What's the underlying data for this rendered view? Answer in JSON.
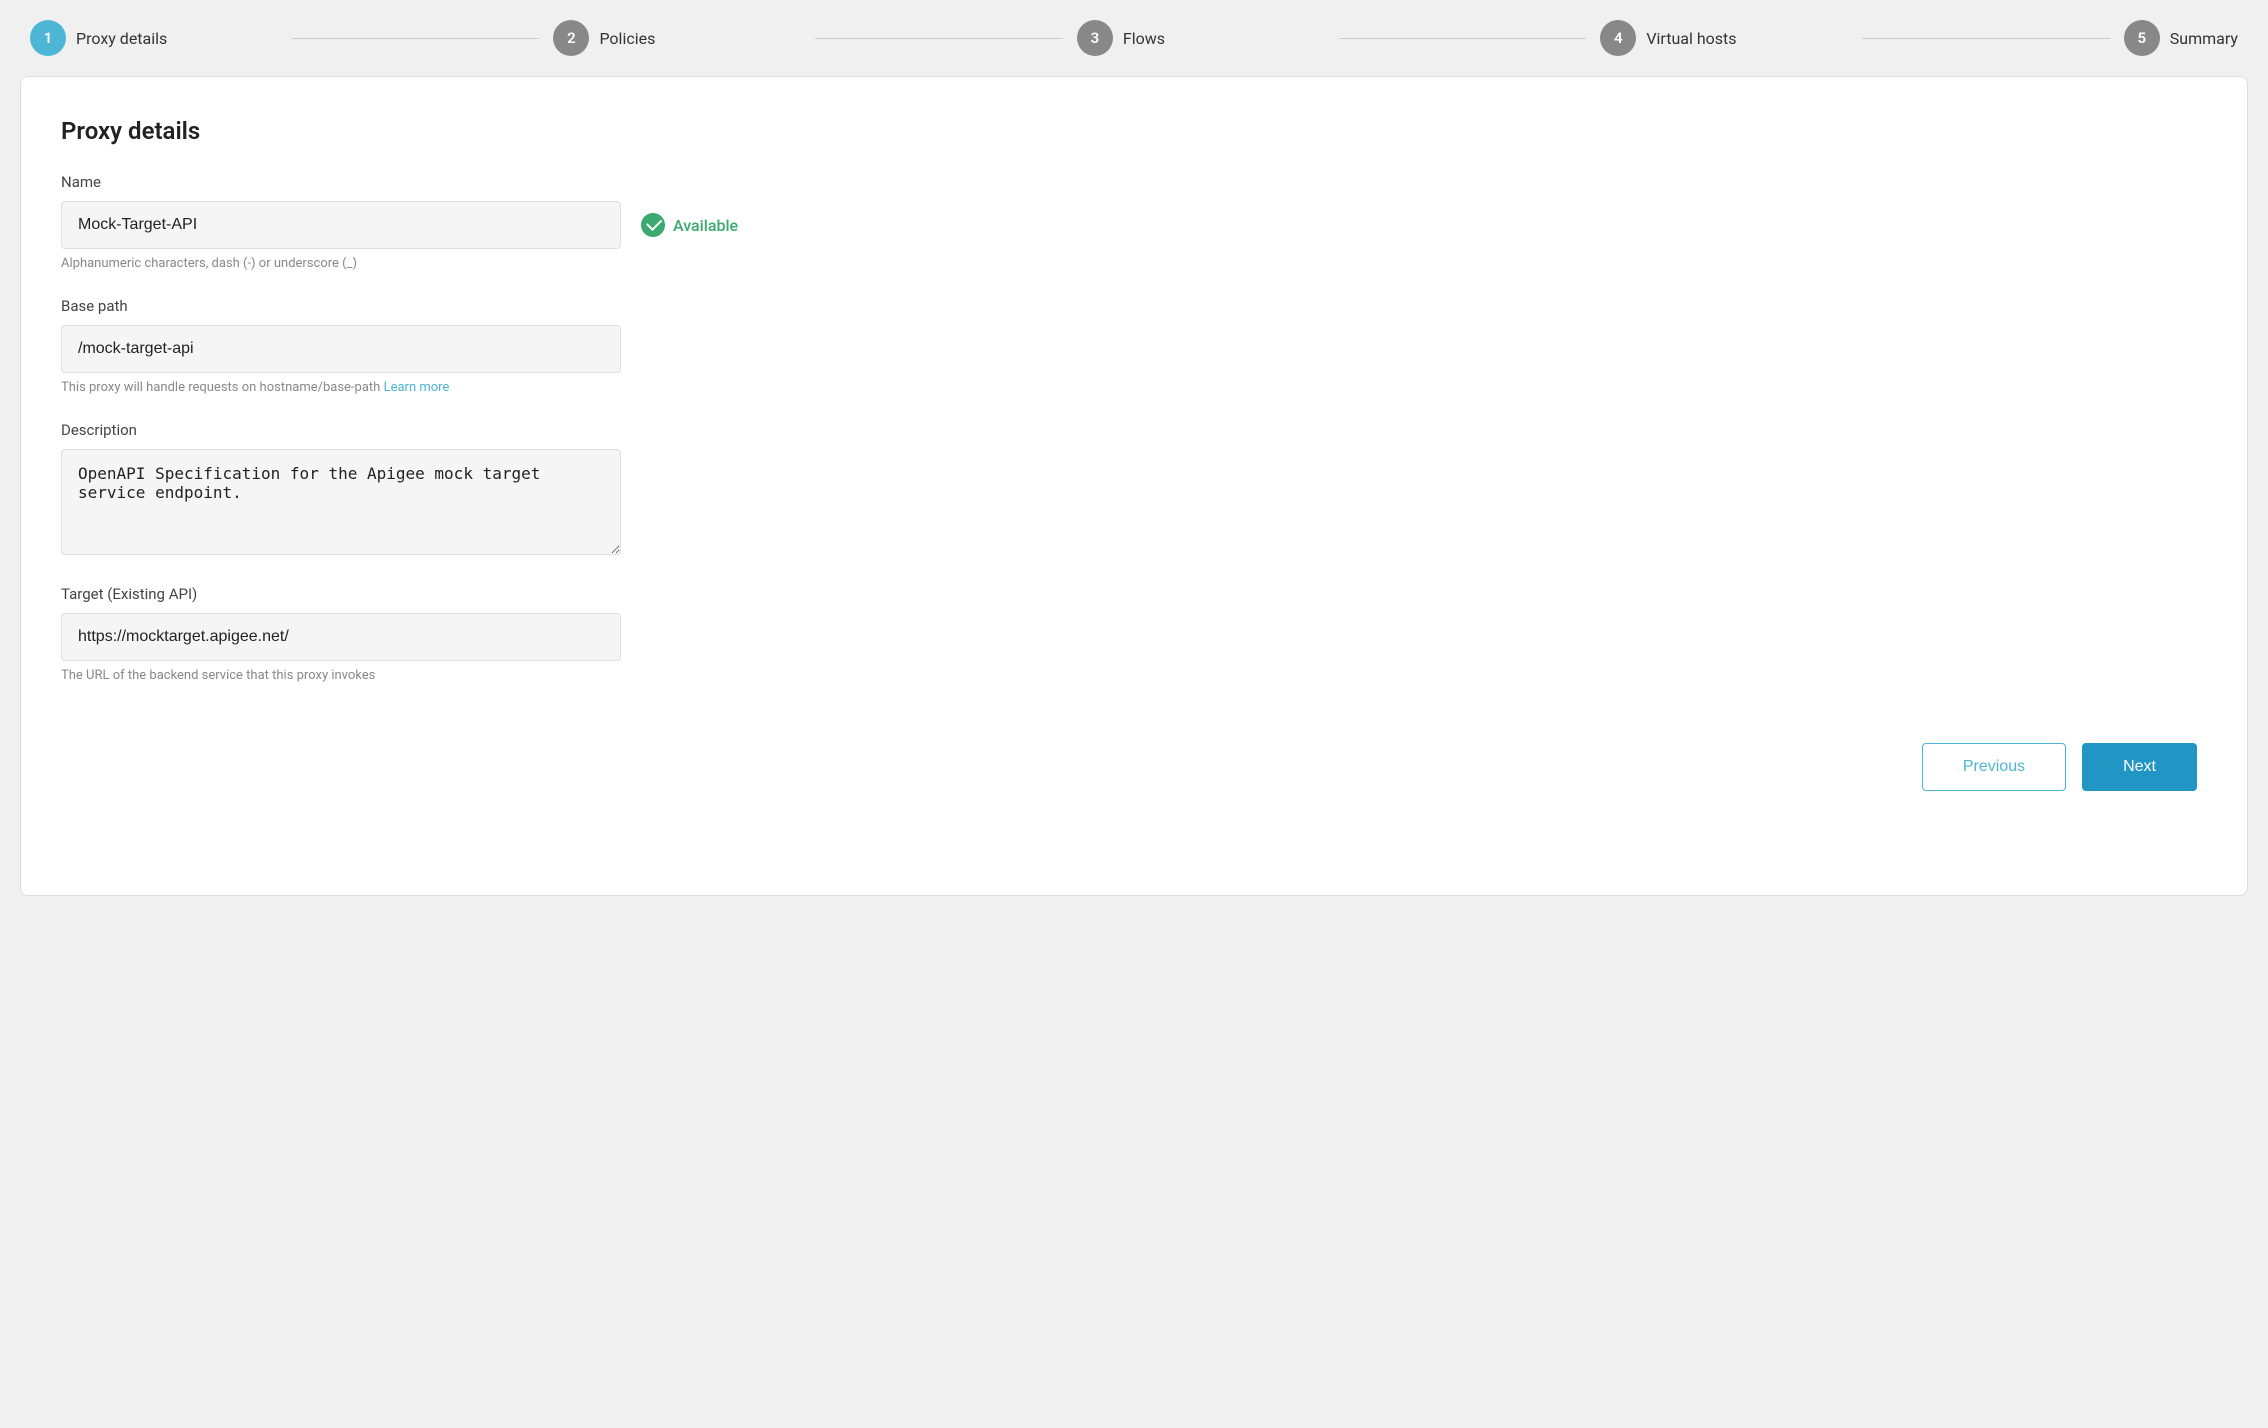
{
  "stepper": {
    "steps": [
      {
        "id": 1,
        "label": "Proxy details",
        "active": true
      },
      {
        "id": 2,
        "label": "Policies",
        "active": false
      },
      {
        "id": 3,
        "label": "Flows",
        "active": false
      },
      {
        "id": 4,
        "label": "Virtual hosts",
        "active": false
      },
      {
        "id": 5,
        "label": "Summary",
        "active": false
      }
    ]
  },
  "card": {
    "title": "Proxy details"
  },
  "form": {
    "name_label": "Name",
    "name_value": "Mock-Target-API",
    "name_hint": "Alphanumeric characters, dash (-) or underscore (_)",
    "availability_label": "Available",
    "base_path_label": "Base path",
    "base_path_value": "/mock-target-api",
    "base_path_hint": "This proxy will handle requests on hostname/base-path",
    "base_path_hint_link": "Learn more",
    "description_label": "Description",
    "description_value": "OpenAPI Specification for the Apigee mock target service endpoint.",
    "target_label": "Target (Existing API)",
    "target_value": "https://mocktarget.apigee.net/",
    "target_hint": "The URL of the backend service that this proxy invokes"
  },
  "buttons": {
    "previous": "Previous",
    "next": "Next"
  },
  "colors": {
    "active_step": "#4db6d4",
    "inactive_step": "#888888",
    "available": "#3aaa6f",
    "primary_btn": "#2196c4",
    "link": "#4db6d4"
  }
}
